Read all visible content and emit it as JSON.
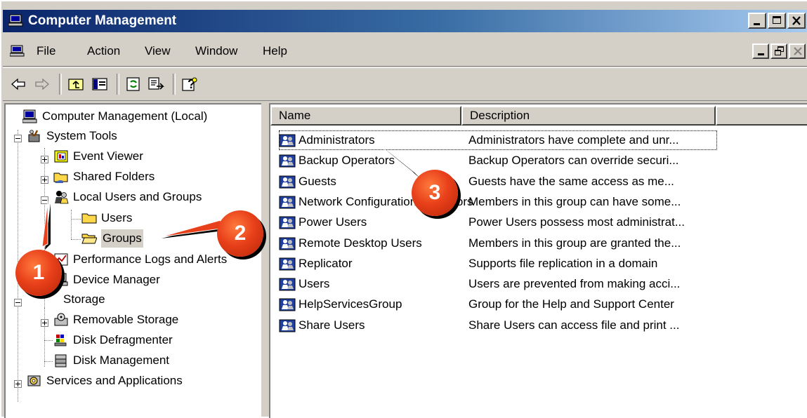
{
  "window": {
    "title": "Computer Management"
  },
  "menu": [
    {
      "label": "File"
    },
    {
      "label": "Action"
    },
    {
      "label": "View"
    },
    {
      "label": "Window"
    },
    {
      "label": "Help"
    }
  ],
  "tree": {
    "root": "Computer Management (Local)",
    "system_tools": "System Tools",
    "event_viewer": "Event Viewer",
    "shared_folders": "Shared Folders",
    "local_users_groups": "Local Users and Groups",
    "users": "Users",
    "groups": "Groups",
    "performance_logs": "Performance Logs and Alerts",
    "device_manager": "Device Manager",
    "storage": "Storage",
    "removable_storage": "Removable Storage",
    "disk_defragmenter": "Disk Defragmenter",
    "disk_management": "Disk Management",
    "services_apps": "Services and Applications"
  },
  "list": {
    "columns": [
      "Name",
      "Description"
    ],
    "rows": [
      {
        "name": "Administrators",
        "description": "Administrators have complete and unr..."
      },
      {
        "name": "Backup Operators",
        "description": "Backup Operators can override securi..."
      },
      {
        "name": "Guests",
        "description": "Guests have the same access as me..."
      },
      {
        "name": "Network Configuration Operators",
        "description": "Members in this group can have some..."
      },
      {
        "name": "Power Users",
        "description": "Power Users possess most administrat..."
      },
      {
        "name": "Remote Desktop Users",
        "description": "Members in this group are granted the..."
      },
      {
        "name": "Replicator",
        "description": "Supports file replication in a domain"
      },
      {
        "name": "Users",
        "description": "Users are prevented from making acci..."
      },
      {
        "name": "HelpServicesGroup",
        "description": "Group for the Help and Support Center"
      },
      {
        "name": "Share Users",
        "description": "Share Users can access file and print ..."
      }
    ]
  },
  "callouts": [
    "1",
    "2",
    "3"
  ],
  "colors": {
    "titlebar": "#0a246a",
    "callout": "#e8401a",
    "chrome": "#d4d0c8"
  }
}
